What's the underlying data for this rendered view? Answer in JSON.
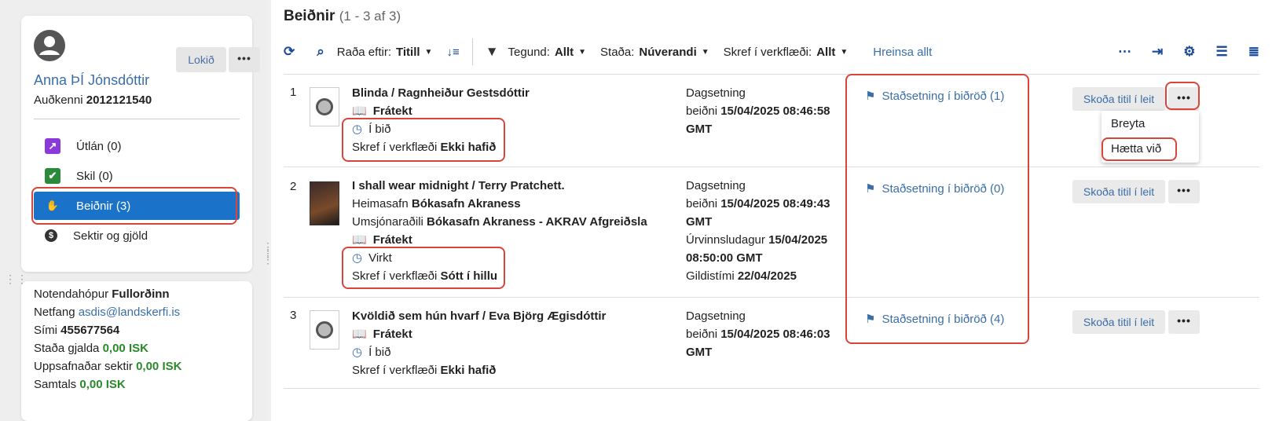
{
  "patron": {
    "lokid_label": "Lokið",
    "more_label": "•••",
    "name": "Anna ÞÍ Jónsdóttir",
    "id_label": "Auðkenni",
    "id_value": "2012121540"
  },
  "nav": {
    "items": [
      {
        "label": "Útlán (0)"
      },
      {
        "label": "Skil (0)"
      },
      {
        "label": "Beiðnir (3)"
      },
      {
        "label": "Sektir og gjöld"
      }
    ]
  },
  "info": {
    "group_label": "Notendahópur",
    "group_value": "Fullorðinn",
    "email_label": "Netfang",
    "email_value": "asdis@landskerfi.is",
    "phone_label": "Sími",
    "phone_value": "455677564",
    "balance_label": "Staða gjalda",
    "balance_value": "0,00 ISK",
    "fines_label": "Uppsafnaðar sektir",
    "fines_value": "0,00 ISK",
    "total_label": "Samtals",
    "total_value": "0,00 ISK"
  },
  "main": {
    "title": "Beiðnir",
    "count": "(1 - 3 af 3)"
  },
  "toolbar": {
    "sort_label": "Raða eftir:",
    "sort_value": "Titill",
    "type_label": "Tegund:",
    "type_value": "Allt",
    "status_label": "Staða:",
    "status_value": "Núverandi",
    "workflow_label": "Skref í verkflæði:",
    "workflow_value": "Allt",
    "clear_label": "Hreinsa allt"
  },
  "rows": [
    {
      "num": "1",
      "title": "Blinda / Ragnheiður Gestsdóttir",
      "type": "Frátekt",
      "status": "Í bið",
      "workflow_label": "Skref í verkflæði",
      "workflow_value": "Ekki hafið",
      "date_label": "Dagsetning",
      "date_prefix": "beiðni",
      "date_value": "15/04/2025 08:46:58",
      "date_tz": "GMT",
      "queue": "Staðsetning í biðröð (1)",
      "view_label": "Skoða titil í leit"
    },
    {
      "num": "2",
      "title": "I shall wear midnight / Terry Pratchett.",
      "home_label": "Heimasafn",
      "home_value": "Bókasafn Akraness",
      "mgr_label": "Umsjónaraðili",
      "mgr_value": "Bókasafn Akraness - AKRAV Afgreiðsla",
      "type": "Frátekt",
      "status": "Virkt",
      "workflow_label": "Skref í verkflæði",
      "workflow_value": "Sótt í hillu",
      "date_label": "Dagsetning",
      "date_prefix": "beiðni",
      "date_value": "15/04/2025 08:49:43",
      "date_tz": "GMT",
      "expiry_label": "Úrvinnsludagur",
      "expiry_value": "15/04/2025",
      "expiry_time": "08:50:00 GMT",
      "valid_label": "Gildistími",
      "valid_value": "22/04/2025",
      "queue": "Staðsetning í biðröð (0)",
      "view_label": "Skoða titil í leit"
    },
    {
      "num": "3",
      "title": "Kvöldið sem hún hvarf / Eva Björg Ægisdóttir",
      "type": "Frátekt",
      "status": "Í bið",
      "workflow_label": "Skref í verkflæði",
      "workflow_value": "Ekki hafið",
      "date_label": "Dagsetning",
      "date_prefix": "beiðni",
      "date_value": "15/04/2025 08:46:03",
      "date_tz": "GMT",
      "queue": "Staðsetning í biðröð (4)",
      "view_label": "Skoða titil í leit"
    }
  ],
  "dropdown": {
    "edit": "Breyta",
    "cancel": "Hætta við"
  },
  "colors": {
    "accent": "#1a73c8",
    "link": "#3a6ea8",
    "highlight": "#d8453a",
    "green": "#2a8a2a"
  }
}
